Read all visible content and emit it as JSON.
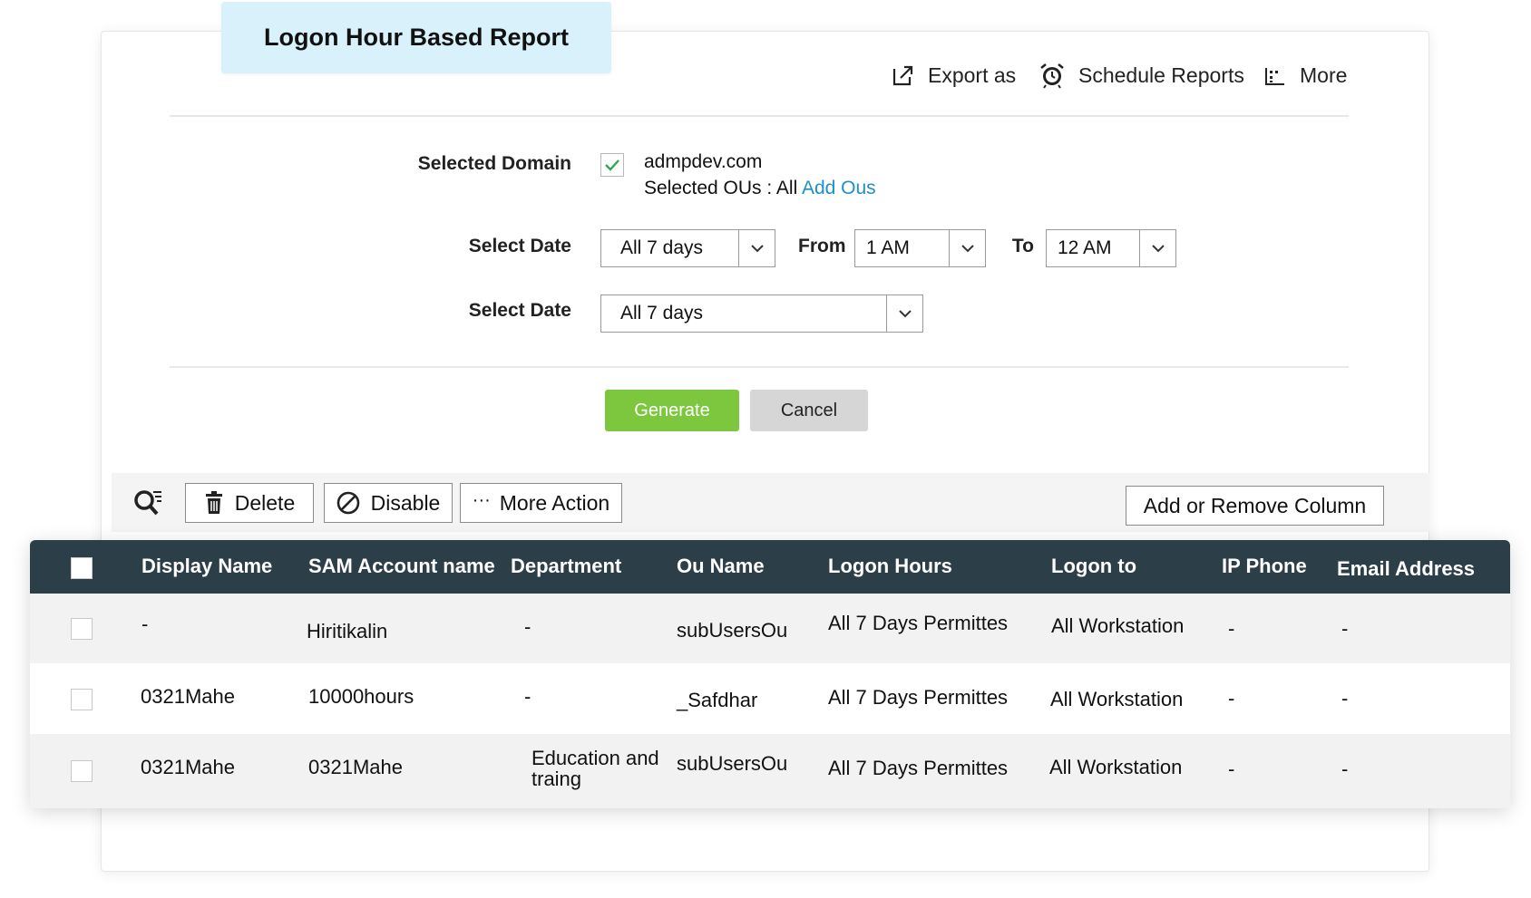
{
  "report": {
    "title": "Logon Hour Based Report"
  },
  "toolbar": {
    "export_label": "Export as",
    "schedule_label": "Schedule Reports",
    "more_label": "More"
  },
  "form": {
    "domain_label": "Selected Domain",
    "domain_checked": true,
    "domain_value": "admpdev.com",
    "ous_prefix": "Selected OUs : All",
    "ous_link": "Add Ous",
    "date_label_1": "Select Date",
    "date_select_1": "All 7 days",
    "from_label": "From",
    "from_value": "1 AM",
    "to_label": "To",
    "to_value": "12 AM",
    "date_label_2": "Select Date",
    "date_select_2": "All 7 days",
    "generate_label": "Generate",
    "cancel_label": "Cancel"
  },
  "actions": {
    "delete_label": "Delete",
    "disable_label": "Disable",
    "more_action_label": "More Action",
    "columns_label": "Add or Remove Column"
  },
  "table": {
    "columns": [
      "Display Name",
      "SAM Account name",
      "Department",
      "Ou Name",
      "Logon Hours",
      "Logon to",
      "IP Phone",
      "Email Address"
    ],
    "rows": [
      {
        "display": "-",
        "sam": "Hiritikalin",
        "dept": "-",
        "ou": "subUsersOu",
        "hours": "All 7 Days Permittes",
        "logon_to": "All Workstation",
        "ip": "-",
        "email": "-"
      },
      {
        "display": "0321Mahe",
        "sam": "10000hours",
        "dept": "-",
        "ou": "_Safdhar",
        "hours": "All 7 Days Permittes",
        "logon_to": "All Workstation",
        "ip": "-",
        "email": "-"
      },
      {
        "display": "0321Mahe",
        "sam": "0321Mahe",
        "dept": "Education and traing",
        "ou": "subUsersOu",
        "hours": "All 7 Days Permittes",
        "logon_to": "All Workstation",
        "ip": "-",
        "email": "-"
      }
    ]
  },
  "colors": {
    "accent_green": "#7dc73f",
    "header_bg": "#2c3e48",
    "link_blue": "#1e8fc9",
    "title_bg": "#d8f1fb"
  }
}
